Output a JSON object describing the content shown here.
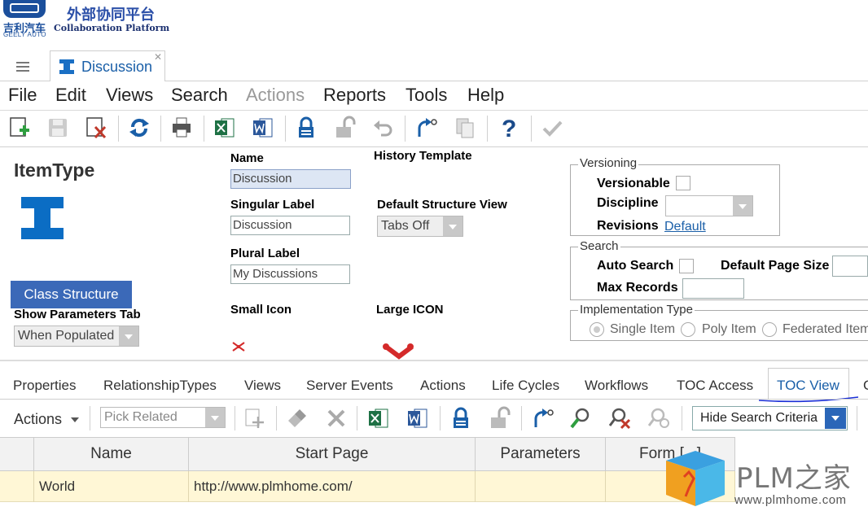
{
  "header": {
    "brand_cn": "吉利汽车",
    "brand_en": "GEELY AUTO",
    "platform_cn": "外部协同平台",
    "platform_en": "Collaboration Platform"
  },
  "tabs": [
    {
      "label": "Discussion",
      "active": true
    }
  ],
  "menu": {
    "items": [
      {
        "label": "File"
      },
      {
        "label": "Edit"
      },
      {
        "label": "Views"
      },
      {
        "label": "Search"
      },
      {
        "label": "Actions",
        "disabled": true
      },
      {
        "label": "Reports"
      },
      {
        "label": "Tools"
      },
      {
        "label": "Help"
      }
    ]
  },
  "toolbar": {
    "icons": [
      "new-icon",
      "save-icon",
      "delete-icon",
      "refresh-icon",
      "print-icon",
      "excel-icon",
      "word-icon",
      "lock-icon",
      "unlock-icon",
      "undo-icon",
      "promote-icon",
      "copy-icon",
      "help-icon",
      "done-icon"
    ]
  },
  "form": {
    "title": "ItemType",
    "class_structure_label": "Class Structure",
    "show_params_label": "Show Parameters Tab",
    "show_params_value": "When Populated",
    "name_label": "Name",
    "name_value": "Discussion",
    "singular_label": "Singular Label",
    "singular_value": "Discussion",
    "plural_label": "Plural Label",
    "plural_value": "My Discussions",
    "small_icon_label": "Small Icon",
    "history_template_label": "History Template",
    "default_structure_label": "Default Structure View",
    "default_structure_value": "Tabs Off",
    "large_icon_label": "Large ICON"
  },
  "versioning": {
    "title": "Versioning",
    "versionable_label": "Versionable",
    "discipline_label": "Discipline",
    "revisions_label": "Revisions",
    "revisions_link": "Default"
  },
  "search": {
    "title": "Search",
    "auto_search_label": "Auto Search",
    "default_page_size_label": "Default Page Size",
    "max_records_label": "Max Records"
  },
  "implementation": {
    "title": "Implementation Type",
    "options": [
      {
        "label": "Single Item",
        "selected": true
      },
      {
        "label": "Poly Item",
        "selected": false
      },
      {
        "label": "Federated Item",
        "selected": false
      }
    ]
  },
  "lower_tabs": {
    "items": [
      {
        "label": "Properties"
      },
      {
        "label": "RelationshipTypes"
      },
      {
        "label": "Views"
      },
      {
        "label": "Server Events"
      },
      {
        "label": "Actions"
      },
      {
        "label": "Life Cycles"
      },
      {
        "label": "Workflows"
      },
      {
        "label": "TOC Access"
      },
      {
        "label": "TOC View",
        "active": true
      },
      {
        "label": "C"
      }
    ]
  },
  "rel_toolbar": {
    "actions_label": "Actions",
    "pick_related": "Pick Related",
    "hide_search": "Hide Search Criteria"
  },
  "grid": {
    "columns": [
      "Name",
      "Start Page",
      "Parameters",
      "Form [...]"
    ],
    "rows": [
      {
        "name": "World",
        "start_page": "http://www.plmhome.com/",
        "parameters": "",
        "form": ""
      }
    ]
  },
  "watermark": {
    "brand": "PLM之家",
    "url": "www.plmhome.com"
  },
  "colors": {
    "accent": "#1a5fa8",
    "class_button": "#3b69b8",
    "row_highlight": "#fff7d6"
  }
}
